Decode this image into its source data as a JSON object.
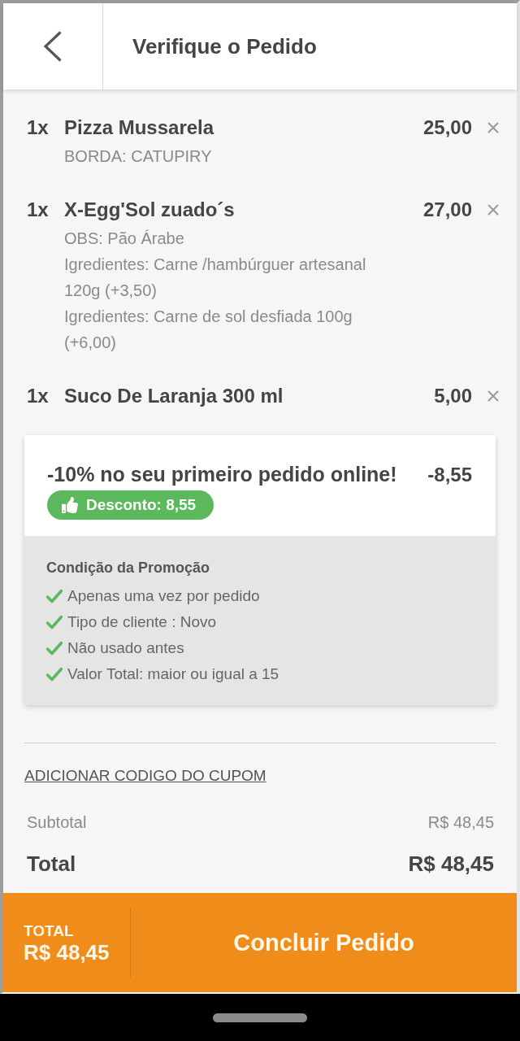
{
  "header": {
    "title": "Verifique o Pedido"
  },
  "items": [
    {
      "quantity": "1x",
      "name": "Pizza Mussarela",
      "price": "25,00",
      "details": [
        "BORDA: CATUPIRY"
      ]
    },
    {
      "quantity": "1x",
      "name": "X-Egg'Sol zuado´s",
      "price": "27,00",
      "details": [
        "OBS: Pão Árabe",
        "Igredientes: Carne /hambúrguer artesanal 120g (+3,50)",
        "Igredientes: Carne de sol desfiada 100g (+6,00)"
      ]
    },
    {
      "quantity": "1x",
      "name": "Suco De Laranja 300 ml",
      "price": "5,00"
    }
  ],
  "promo": {
    "title": "-10% no seu primeiro pedido online!",
    "amount": "-8,55",
    "badge": "Desconto: 8,55",
    "conditions_title": "Condição da Promoção",
    "conditions": [
      {
        "text": "Apenas uma vez por pedido",
        "met": true
      },
      {
        "text": "Tipo de cliente : Novo",
        "met": true
      },
      {
        "text": "Não usado antes",
        "met": true
      },
      {
        "text": "Valor Total: maior ou igual a 15",
        "met": true
      }
    ]
  },
  "coupon_link": "ADICIONAR CODIGO DO CUPOM",
  "summary": [
    {
      "kind": "subtotal",
      "label": "Subtotal",
      "value": "R$ 48,45"
    },
    {
      "kind": "total",
      "label": "Total",
      "value": "R$ 48,45"
    }
  ],
  "footer": {
    "total_label": "TOTAL",
    "total": "R$ 48,45",
    "button": "Concluir Pedido"
  }
}
